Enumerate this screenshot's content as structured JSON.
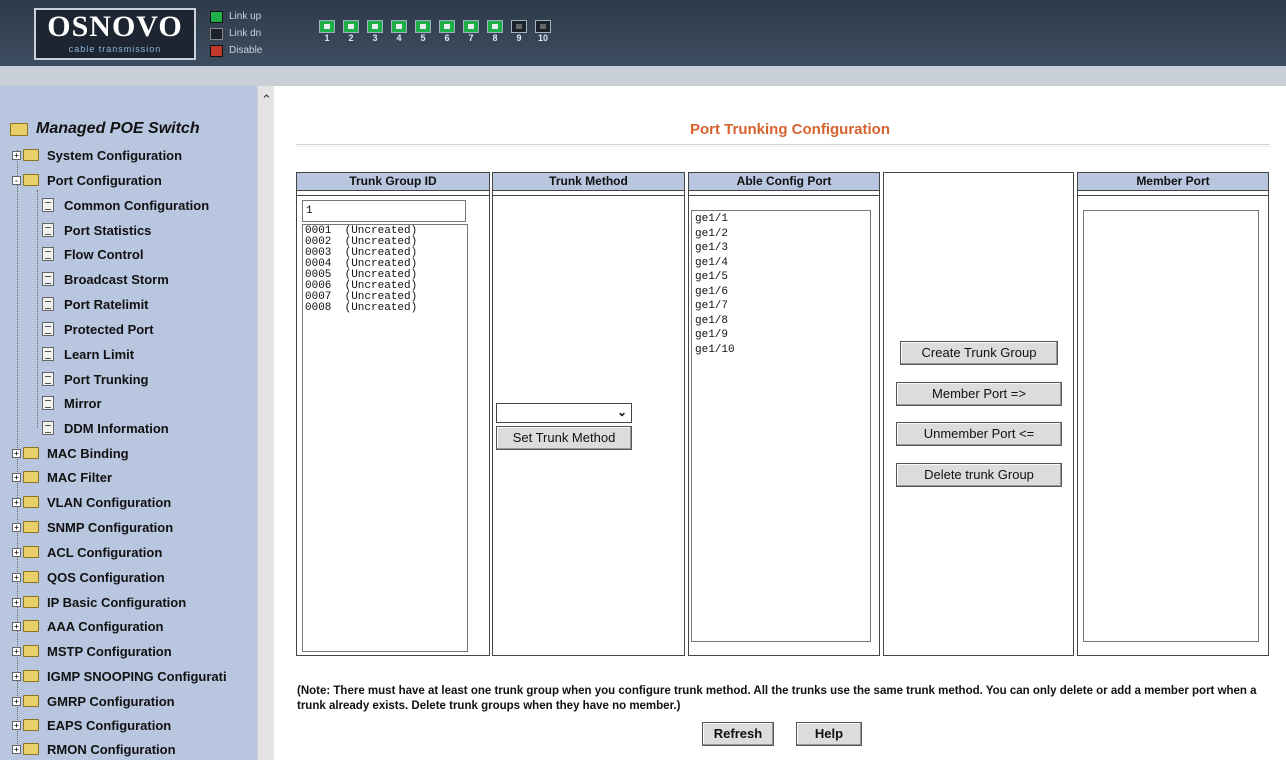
{
  "header": {
    "logo_title": "OSNOVO",
    "logo_subtitle": "cable transmission",
    "legend": [
      {
        "label": "Link up",
        "color": "#20b04a"
      },
      {
        "label": "Link dn",
        "color": "#1b222c"
      },
      {
        "label": "Disable",
        "color": "#c0392b"
      }
    ],
    "ports": [
      "1",
      "2",
      "3",
      "4",
      "5",
      "6",
      "7",
      "8",
      "9",
      "10"
    ]
  },
  "sidebar": {
    "root": "Managed POE Switch",
    "system_config": "System Configuration",
    "port_config": "Port Configuration",
    "port_children": [
      "Common Configuration",
      "Port Statistics",
      "Flow Control",
      "Broadcast Storm",
      "Port Ratelimit",
      "Protected Port",
      "Learn Limit",
      "Port Trunking",
      "Mirror",
      "DDM Information"
    ],
    "others": [
      "MAC Binding",
      "MAC Filter",
      "VLAN Configuration",
      "SNMP Configuration",
      "ACL Configuration",
      "QOS Configuration",
      "IP Basic Configuration",
      "AAA Configuration",
      "MSTP Configuration",
      "IGMP SNOOPING Configurati",
      "GMRP Configuration",
      "EAPS Configuration",
      "RMON Configuration"
    ]
  },
  "main": {
    "title": "Port Trunking Configuration",
    "columns": {
      "trunk_group_id": "Trunk Group ID",
      "trunk_method": "Trunk Method",
      "able_config_port": "Able Config Port",
      "member_port": "Member Port"
    },
    "trunk_id_value": "1",
    "trunk_groups": [
      "0001  (Uncreated)",
      "0002  (Uncreated)",
      "0003  (Uncreated)",
      "0004  (Uncreated)",
      "0005  (Uncreated)",
      "0006  (Uncreated)",
      "0007  (Uncreated)",
      "0008  (Uncreated)"
    ],
    "set_trunk_method": "Set Trunk Method",
    "trunk_method_value": "",
    "able_ports": [
      "ge1/1",
      "ge1/2",
      "ge1/3",
      "ge1/4",
      "ge1/5",
      "ge1/6",
      "ge1/7",
      "ge1/8",
      "ge1/9",
      "ge1/10"
    ],
    "buttons": {
      "create": "Create Trunk Group",
      "member": "Member Port =>",
      "unmember": "Unmember Port <=",
      "delete": "Delete trunk Group"
    },
    "note": "(Note: There must have at least one trunk group when you configure trunk method. All the trunks use the same trunk method. You can only delete or add a member port when a trunk already exists. Delete trunk groups when they have no member.)",
    "refresh": "Refresh",
    "help": "Help"
  }
}
